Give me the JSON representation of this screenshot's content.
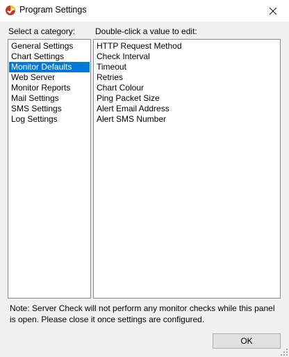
{
  "window": {
    "title": "Program Settings"
  },
  "labels": {
    "category": "Select a category:",
    "values": "Double-click a value to edit:"
  },
  "categories": [
    {
      "label": "General Settings",
      "selected": false
    },
    {
      "label": "Chart Settings",
      "selected": false
    },
    {
      "label": "Monitor Defaults",
      "selected": true
    },
    {
      "label": "Web Server",
      "selected": false
    },
    {
      "label": "Monitor Reports",
      "selected": false
    },
    {
      "label": "Mail Settings",
      "selected": false
    },
    {
      "label": "SMS Settings",
      "selected": false
    },
    {
      "label": "Log Settings",
      "selected": false
    }
  ],
  "values": [
    "HTTP Request Method",
    "Check Interval",
    "Timeout",
    "Retries",
    "Chart Colour",
    "Ping Packet Size",
    "Alert Email Address",
    "Alert SMS Number"
  ],
  "note": "Note: Server Check will not perform any monitor checks while this panel is open. Please close it once settings are configured.",
  "buttons": {
    "ok": "OK"
  },
  "colors": {
    "selection": "#0078d7",
    "window": "#f0f0f0"
  }
}
